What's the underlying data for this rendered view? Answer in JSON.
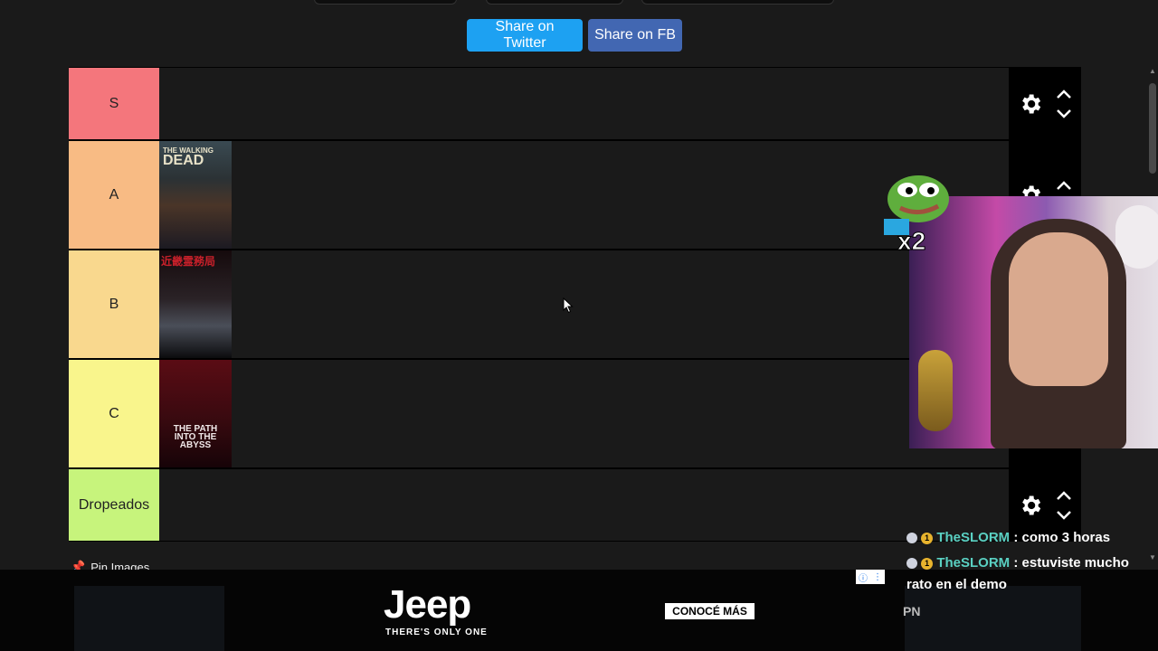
{
  "share": {
    "twitter_label": "Share on Twitter",
    "fb_label": "Share on FB"
  },
  "tiers": [
    {
      "label": "S",
      "color": "#f4767c",
      "items": []
    },
    {
      "label": "A",
      "color": "#f8bb84",
      "items": [
        "The Walking Dead: A New Frontier"
      ]
    },
    {
      "label": "B",
      "color": "#f9d88e",
      "items": [
        "近畿霊務局"
      ]
    },
    {
      "label": "C",
      "color": "#f9f58c",
      "items": [
        "THE PATH INTO THE ABYSS"
      ]
    },
    {
      "label": "Dropeados",
      "color": "#c7f47c",
      "items": []
    }
  ],
  "covers": {
    "walking_dead_title": "THE WALKING",
    "walking_dead_title2": "DEAD",
    "kinki_title": "近畿霊務局",
    "abyss_title": "THE PATH INTO THE ABYSS"
  },
  "pin_images_label": "Pin Images",
  "ad": {
    "brand": "Jeep",
    "tagline": "THERE'S ONLY ONE",
    "cta": "CONOCÉ MÁS",
    "right_text": "PN"
  },
  "emote": {
    "multiplier": "x2"
  },
  "chat": [
    {
      "user": "TheSLORM",
      "text": ": como 3 horas"
    },
    {
      "user": "TheSLORM",
      "text": ": estuviste mucho rato en el demo"
    }
  ],
  "chat_badge": "1",
  "colors": {
    "twitter": "#1da1f2",
    "facebook": "#4267b2",
    "chat_user": "#5ad0c2",
    "background": "#1a1a1a"
  },
  "icons": [
    "gear-icon",
    "chevron-up-icon",
    "chevron-down-icon",
    "pin-icon",
    "cursor-icon"
  ]
}
